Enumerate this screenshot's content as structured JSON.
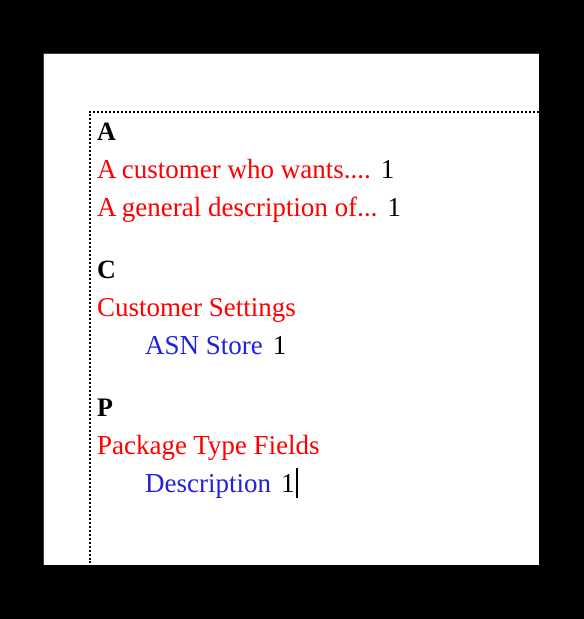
{
  "document": {
    "background_color": "#000000",
    "page_color": "#ffffff",
    "field_border_style": "dotted",
    "colors": {
      "heading": "#000000",
      "level1_entry": "#ff0000",
      "level2_entry": "#2222dd",
      "page_number": "#000000"
    }
  },
  "index": {
    "sections": [
      {
        "heading": "A",
        "entries": [
          {
            "level": 1,
            "text": "A customer who wants....",
            "page": "1"
          },
          {
            "level": 1,
            "text": "A general description of...",
            "page": "1"
          }
        ]
      },
      {
        "heading": "C",
        "entries": [
          {
            "level": 1,
            "text": "Customer Settings",
            "page": ""
          },
          {
            "level": 2,
            "text": "ASN Store",
            "page": "1"
          }
        ]
      },
      {
        "heading": "P",
        "entries": [
          {
            "level": 1,
            "text": "Package Type Fields",
            "page": ""
          },
          {
            "level": 2,
            "text": "Description",
            "page": "1"
          }
        ]
      }
    ]
  },
  "caret": {
    "visible": true,
    "after": "Description 1"
  }
}
